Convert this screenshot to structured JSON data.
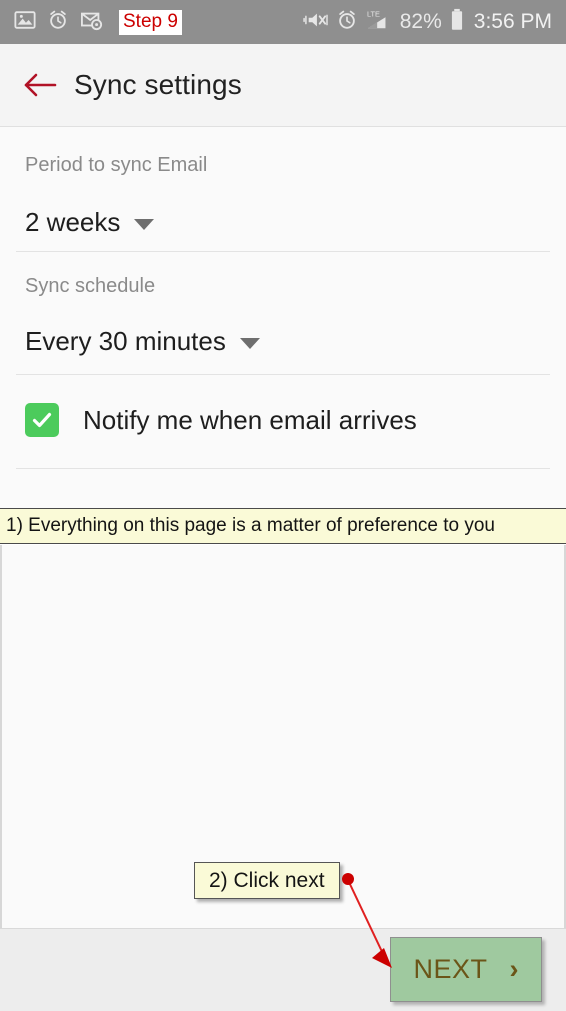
{
  "status_bar": {
    "left_icons": [
      "image-icon",
      "alarm-clock-icon",
      "email-badge-icon"
    ],
    "step_badge": "Step 9",
    "step_badge_color": "#cc0000",
    "right_icons": [
      "mute-vibrate-icon",
      "alarm-clock-icon",
      "lte-signal-icon",
      "battery-icon"
    ],
    "network_label": "LTE",
    "battery_percent": "82%",
    "clock": "3:56 PM",
    "background": "#8f8f8f"
  },
  "app_bar": {
    "back_icon": "back-arrow-icon",
    "back_icon_color": "#b11226",
    "title": "Sync settings"
  },
  "settings": {
    "period": {
      "label": "Period to sync Email",
      "value": "2 weeks",
      "caret_icon": "chevron-down-icon"
    },
    "schedule": {
      "label": "Sync schedule",
      "value": "Every 30 minutes",
      "caret_icon": "chevron-down-icon"
    },
    "notify": {
      "label": "Notify me when email arrives",
      "checked": true,
      "check_color": "#4ccb5c"
    }
  },
  "annotations": {
    "banner_text": "1) Everything on this page is a matter of preference to you",
    "callout_text": "2) Click next",
    "arrow_color": "#e02020",
    "note_background": "#fafad7"
  },
  "bottom_bar": {
    "next_label": "NEXT",
    "next_chevron": "›",
    "highlight_color": "#9fc99f",
    "text_color": "#6b5518"
  }
}
